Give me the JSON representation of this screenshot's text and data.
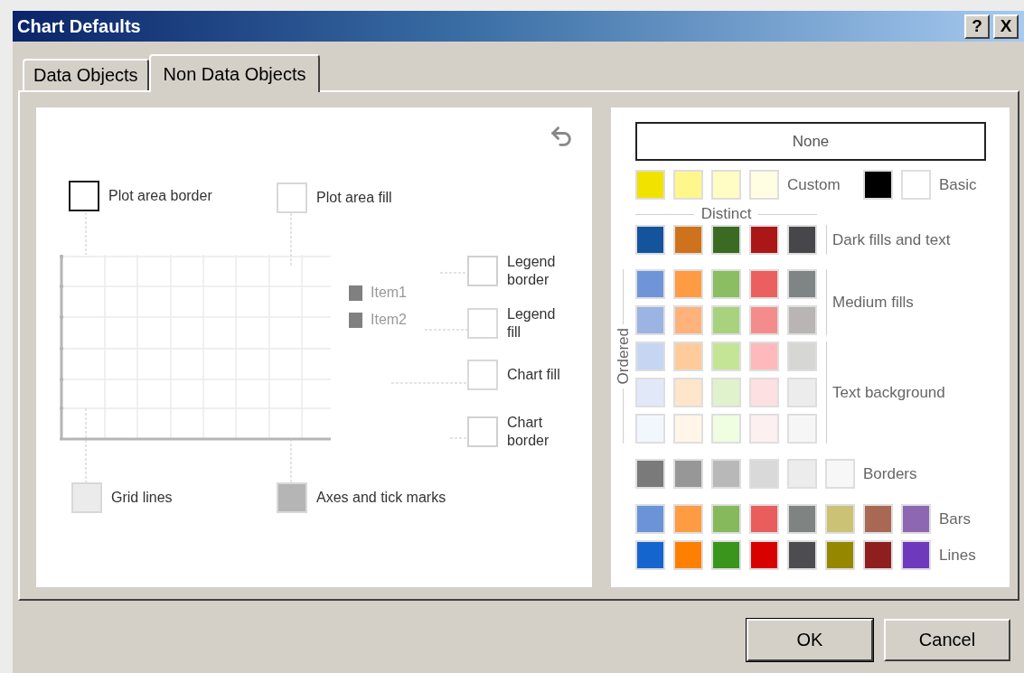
{
  "window": {
    "title": "Chart Defaults",
    "help_button": "?",
    "close_button": "X"
  },
  "tabs": [
    {
      "label": "Data Objects",
      "selected": false
    },
    {
      "label": "Non Data Objects",
      "selected": true
    }
  ],
  "diagram": {
    "targets": [
      {
        "label": "Plot area border",
        "kind": "border",
        "color": "#1a1a1a"
      },
      {
        "label": "Plot area fill",
        "kind": "fill",
        "color": "#ffffff"
      },
      {
        "label": "Legend border",
        "kind": "border",
        "color": "#d0d0d0"
      },
      {
        "label": "Legend fill",
        "kind": "fill",
        "color": "#ffffff"
      },
      {
        "label": "Chart fill",
        "kind": "fill",
        "color": "#ffffff"
      },
      {
        "label": "Chart border",
        "kind": "border",
        "color": "#d0d0d0"
      },
      {
        "label": "Grid lines",
        "kind": "fill",
        "color": "#ebebeb"
      },
      {
        "label": "Axes and tick marks",
        "kind": "fill",
        "color": "#b5b5b5"
      }
    ],
    "legend": [
      {
        "label": "Item1"
      },
      {
        "label": "Item2"
      }
    ]
  },
  "palette": {
    "none_button": "None",
    "custom": {
      "label": "Custom",
      "colors": [
        {
          "color": "#f2e200"
        },
        {
          "color": "#fff78c"
        },
        {
          "color": "#fffcc4"
        },
        {
          "color": "#fffee3"
        }
      ]
    },
    "basic": {
      "label": "Basic",
      "colors": [
        {
          "color": "#000000"
        },
        {
          "color": "#ffffff"
        }
      ]
    },
    "distinct_label": "Distinct",
    "dark": {
      "label": "Dark fills and text",
      "rows": [
        [
          {
            "color": "#14549c"
          },
          {
            "color": "#cf721c"
          },
          {
            "color": "#3b6b23"
          },
          {
            "color": "#ab1616"
          },
          {
            "color": "#47464b"
          }
        ]
      ]
    },
    "ordered_label": "Ordered",
    "medium": {
      "label": "Medium fills",
      "rows": [
        [
          {
            "color": "#6f95d8"
          },
          {
            "color": "#ff9b42"
          },
          {
            "color": "#8bbd62"
          },
          {
            "color": "#ec5f5f"
          },
          {
            "color": "#7f8484"
          }
        ],
        [
          {
            "color": "#9bb4e4"
          },
          {
            "color": "#ffb27a"
          },
          {
            "color": "#a9d27e"
          },
          {
            "color": "#f58c8c"
          },
          {
            "color": "#b8b5b4"
          }
        ]
      ]
    },
    "text_background": {
      "label": "Text background",
      "rows": [
        [
          {
            "color": "#c5d6f3"
          },
          {
            "color": "#ffcb9a"
          },
          {
            "color": "#c4e596"
          },
          {
            "color": "#fdb9bb"
          },
          {
            "color": "#d6d6d3"
          }
        ],
        [
          {
            "color": "#e1e9f8"
          },
          {
            "color": "#ffe5c9"
          },
          {
            "color": "#e0f2cc"
          },
          {
            "color": "#fde0e2"
          },
          {
            "color": "#ececec"
          }
        ],
        [
          {
            "color": "#f2f7fe"
          },
          {
            "color": "#fff6e9"
          },
          {
            "color": "#effde1"
          },
          {
            "color": "#fdf0f1"
          },
          {
            "color": "#f6f6f6"
          }
        ]
      ]
    },
    "borders": {
      "label": "Borders",
      "colors": [
        {
          "color": "#7a7a7a"
        },
        {
          "color": "#979797"
        },
        {
          "color": "#b8b8b8"
        },
        {
          "color": "#d9d9d9"
        },
        {
          "color": "#ececec"
        },
        {
          "color": "#f7f7f7"
        }
      ]
    },
    "bars": {
      "label": "Bars",
      "colors": [
        {
          "color": "#6a93d8"
        },
        {
          "color": "#ff9b42"
        },
        {
          "color": "#86b95c"
        },
        {
          "color": "#ea5d5d"
        },
        {
          "color": "#7f8382"
        },
        {
          "color": "#cbc275"
        },
        {
          "color": "#a86854"
        },
        {
          "color": "#8d67b1"
        }
      ]
    },
    "lines": {
      "label": "Lines",
      "colors": [
        {
          "color": "#1565cf"
        },
        {
          "color": "#ff7f00"
        },
        {
          "color": "#3a951c"
        },
        {
          "color": "#d90000"
        },
        {
          "color": "#4d4c50"
        },
        {
          "color": "#958700"
        },
        {
          "color": "#8f1f1f"
        },
        {
          "color": "#6f39be"
        }
      ]
    }
  },
  "buttons": [
    {
      "label": "OK",
      "default": true
    },
    {
      "label": "Cancel",
      "default": false
    }
  ]
}
